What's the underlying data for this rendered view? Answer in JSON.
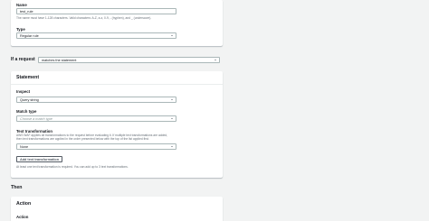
{
  "name_section": {
    "name_label": "Name",
    "name_value": "test_rule",
    "name_hint": "The name must have 1-128 characters. Valid characters: A-Z, a-z, 0-9, - (hyphen), and _ (underscore).",
    "type_label": "Type",
    "type_value": "Regular rule"
  },
  "if_request": {
    "label": "If a request",
    "value": "matches the statement"
  },
  "statement": {
    "title": "Statement",
    "inspect_label": "Inspect",
    "inspect_value": "Query string",
    "match_type_label": "Match type",
    "match_type_placeholder": "Choose a match type",
    "text_transformation_label": "Text transformation",
    "text_transformation_desc": "AWS WAF applies all transformations to the request before evaluating it. If multiple text transformations are added, then text transformations are applied in the order presented below with the top of the list applied first.",
    "text_transformation_value": "None",
    "add_button_label": "Add text transformation",
    "add_button_hint": "At least one text transformation is required. You can add up to 3 text transformations."
  },
  "then_section": {
    "label": "Then"
  },
  "action_card": {
    "title": "Action",
    "action_label": "Action"
  }
}
